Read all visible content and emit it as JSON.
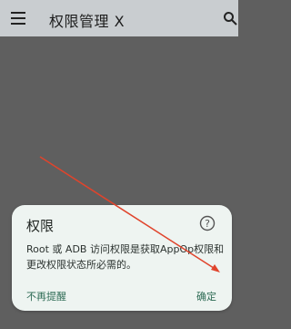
{
  "appbar": {
    "title": "权限管理 X",
    "menu_icon": "menu-icon",
    "search_icon": "search-icon"
  },
  "dialog": {
    "title": "权限",
    "message": "Root 或 ADB 访问权限是获取AppOp权限和更改权限状态所必需的。",
    "help_icon": "help-icon",
    "dismiss_label": "不再提醒",
    "confirm_label": "确定"
  },
  "annotation": {
    "color": "#e0442c"
  }
}
